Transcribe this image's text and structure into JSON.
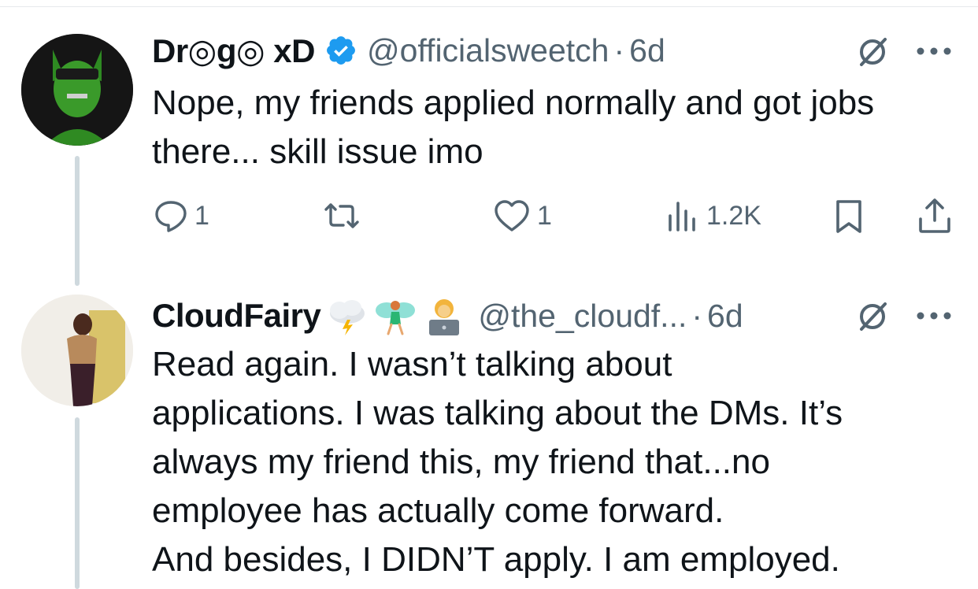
{
  "tweets": [
    {
      "name": "Dr◎g◎ xD",
      "handle": "@officialsweetch",
      "separator": "·",
      "time": "6d",
      "verified": true,
      "text_lines": [
        "Nope, my friends applied normally and got jobs",
        "there... skill issue imo"
      ],
      "actions": {
        "replies": "1",
        "retweets": "",
        "likes": "1",
        "views": "1.2K"
      },
      "icons": [
        "reply-icon",
        "retweet-icon",
        "like-icon",
        "views-icon",
        "bookmark-icon",
        "share-icon",
        "grok-icon",
        "more-icon",
        "verified-icon"
      ]
    },
    {
      "name": "CloudFairy",
      "emojis": [
        "cloud-lightning-emoji",
        "fairy-emoji",
        "technologist-emoji"
      ],
      "handle": "@the_cloudf...",
      "separator": "·",
      "time": "6d",
      "text_lines": [
        "Read again. I wasn’t talking about",
        "applications. I was talking about the DMs.  It’s",
        "always my friend this, my friend that...no",
        "employee has actually come forward.",
        "And besides, I DIDN’T apply. I am employed."
      ]
    }
  ],
  "colors": {
    "text": "#0f1419",
    "secondary": "#536471",
    "verified": "#1d9bf0",
    "thread_line": "#cfd9de",
    "avatar1_green": "#3a9a2a"
  }
}
